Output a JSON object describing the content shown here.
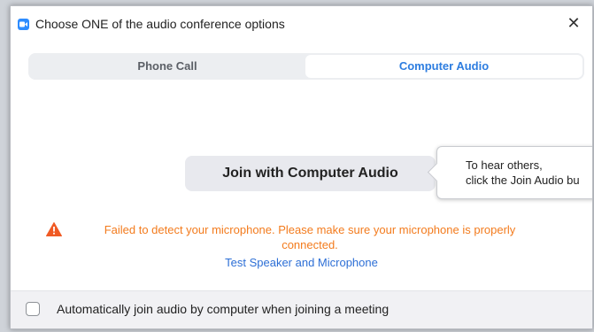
{
  "window": {
    "title": "Choose ONE of the audio conference options",
    "close_glyph": "✕"
  },
  "tabs": [
    {
      "label": "Phone Call",
      "selected": false
    },
    {
      "label": "Computer Audio",
      "selected": true
    }
  ],
  "join_button": {
    "label": "Join with Computer Audio"
  },
  "tooltip": {
    "text": "To hear others,\nclick the Join Audio bu"
  },
  "warning": {
    "icon": "warning-triangle-icon",
    "text": "Failed to detect your microphone. Please make sure your microphone is properly connected."
  },
  "test_link": {
    "label": "Test Speaker and Microphone"
  },
  "auto_join": {
    "label": "Automatically join audio by computer when joining a meeting",
    "checked": false
  },
  "colors": {
    "accent": "#2d8cff",
    "warning": "#f37b1d",
    "link": "#2d6fd6"
  }
}
